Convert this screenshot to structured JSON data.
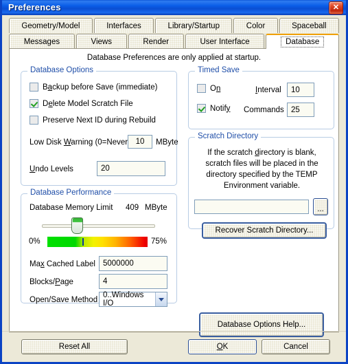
{
  "window": {
    "title": "Preferences",
    "close_icon": "close-icon"
  },
  "tabs": {
    "row1": [
      {
        "label": "Geometry/Model",
        "active": false
      },
      {
        "label": "Interfaces",
        "active": false
      },
      {
        "label": "Library/Startup",
        "active": false
      },
      {
        "label": "Color",
        "active": false
      },
      {
        "label": "Spaceball",
        "active": false
      }
    ],
    "row2": [
      {
        "label": "Messages",
        "active": false
      },
      {
        "label": "Views",
        "active": false
      },
      {
        "label": "Render",
        "active": false
      },
      {
        "label": "User Interface",
        "active": false
      },
      {
        "label": "Database",
        "active": true
      }
    ]
  },
  "main": {
    "header_note": "Database Preferences are only applied at startup."
  },
  "database_options": {
    "legend": "Database Options",
    "checkboxes": [
      {
        "label": "Backup before Save (immediate)",
        "checked": false
      },
      {
        "label": "Delete Model Scratch File",
        "checked": true
      },
      {
        "label": "Preserve Next ID during Rebuild",
        "checked": false
      }
    ],
    "low_disk_label": "Low Disk Warning (0=Never)",
    "low_disk_value": "10",
    "low_disk_unit": "MByte",
    "undo_label": "Undo Levels",
    "undo_value": "20"
  },
  "database_performance": {
    "legend": "Database Performance",
    "memory_limit_label": "Database Memory Limit",
    "memory_limit_value": "409",
    "memory_limit_unit": "MByte",
    "scale_min": "0%",
    "scale_max": "75%",
    "slider_percent": 30,
    "max_cached_label": "Max Cached Label",
    "max_cached_value": "5000000",
    "blocks_page_label": "Blocks/Page",
    "blocks_page_value": "4",
    "open_save_label": "Open/Save Method",
    "open_save_value": "0..Windows I/O"
  },
  "timed_save": {
    "legend": "Timed Save",
    "on_label": "On",
    "on_checked": false,
    "notify_label": "Notify",
    "notify_checked": true,
    "interval_label": "Interval",
    "interval_value": "10",
    "commands_label": "Commands",
    "commands_value": "25"
  },
  "scratch_directory": {
    "legend": "Scratch Directory",
    "note_line1": "If the scratch directory is blank,",
    "note_line2": "scratch files will be placed in the",
    "note_line3": "directory specified by the TEMP",
    "note_line4": "Environment variable.",
    "path_value": "",
    "path_placeholder": "",
    "browse_label": "...",
    "recover_label": "Recover Scratch Directory..."
  },
  "help": {
    "database_options_help_label": "Database Options Help..."
  },
  "footer": {
    "reset_all_label": "Reset All",
    "ok_label": "OK",
    "cancel_label": "Cancel"
  },
  "colors": {
    "titlebar_blue": "#0a5de8",
    "tab_active_accent": "#f0a000",
    "group_legend": "#1f4ea8",
    "panel_bg": "#ece9d8",
    "check_green": "#22a022",
    "close_red": "#c0260c"
  }
}
